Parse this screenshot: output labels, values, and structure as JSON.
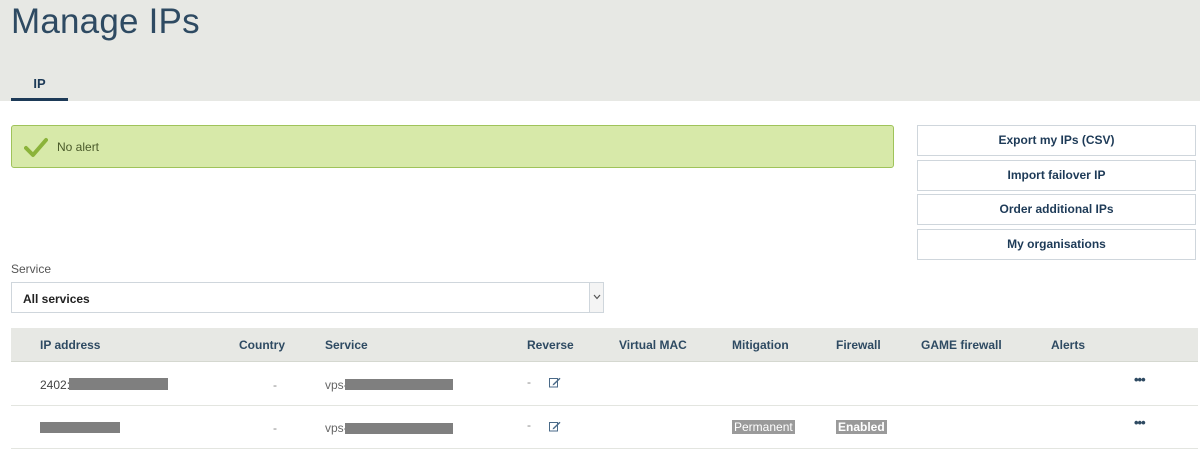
{
  "page": {
    "title": "Manage IPs"
  },
  "tabs": [
    {
      "label": "IP",
      "active": true
    }
  ],
  "alert": {
    "text": "No alert",
    "color": "#d7e9a9",
    "icon": "check-icon"
  },
  "actions": {
    "export": "Export my IPs (CSV)",
    "import": "Import failover IP",
    "order": "Order additional IPs",
    "organisations": "My organisations"
  },
  "filter": {
    "label": "Service",
    "value": "All services"
  },
  "table": {
    "columns": {
      "ip": "IP address",
      "country": "Country",
      "service": "Service",
      "reverse": "Reverse",
      "mac": "Virtual MAC",
      "mitigation": "Mitigation",
      "firewall": "Firewall",
      "game_firewall": "GAME firewall",
      "alerts": "Alerts"
    },
    "rows": [
      {
        "ip_prefix": "2402:",
        "country": "-",
        "service_prefix": "vps-",
        "reverse": "-",
        "mitigation": "",
        "firewall": ""
      },
      {
        "ip_prefix": "",
        "country": "-",
        "service_prefix": "vps-",
        "reverse": "-",
        "mitigation": "Permanent",
        "firewall": "Enabled"
      }
    ]
  }
}
